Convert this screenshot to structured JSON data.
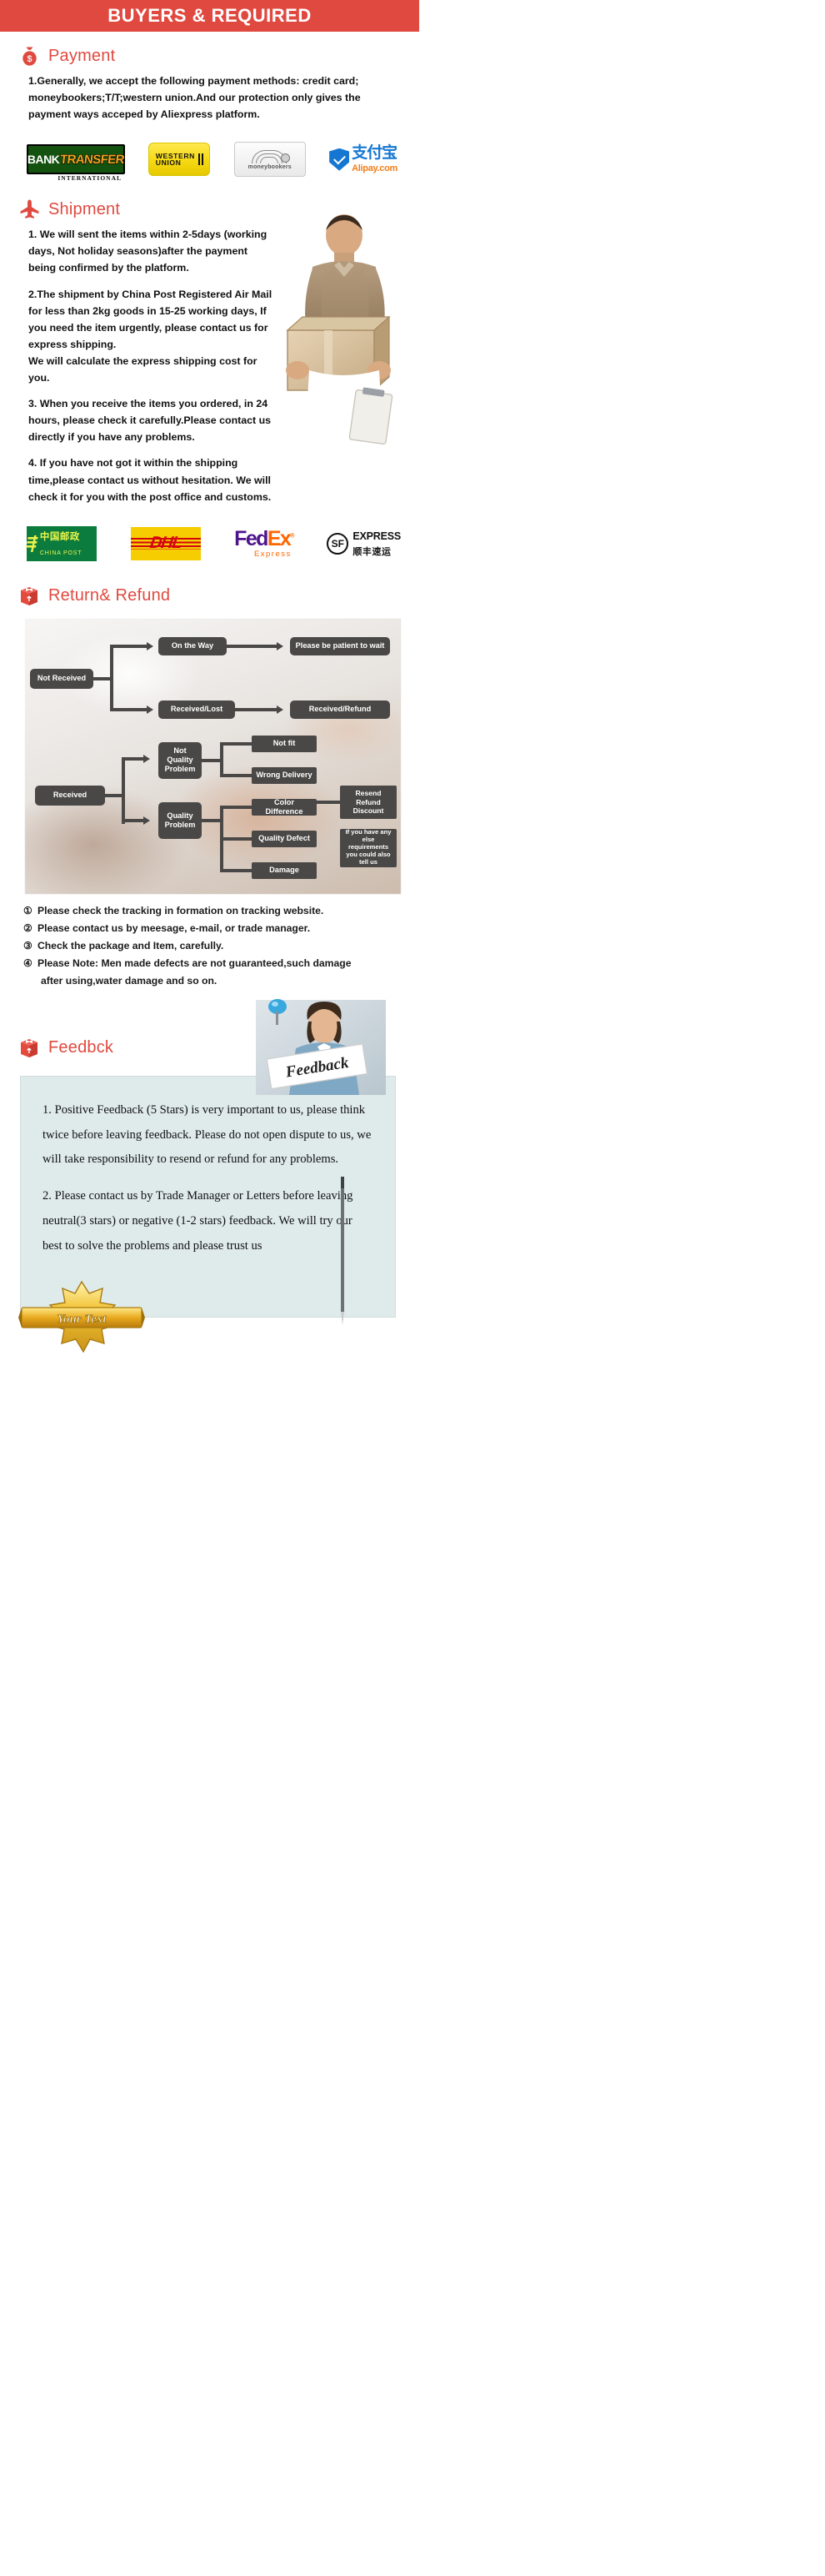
{
  "banner": {
    "title": "BUYERS & REQUIRED"
  },
  "payment": {
    "icon": "money-bag-icon",
    "heading": "Payment",
    "paragraphs": [
      "1.Generally, we accept the following payment methods: credit card; moneybookers;T/T;western union.And our protection only gives the payment ways acceped by Aliexpress platform."
    ],
    "logos": [
      {
        "name": "bank-transfer-international-logo",
        "line1": "BANK",
        "line2": "TRANSFER",
        "line3": "INTERNATIONAL"
      },
      {
        "name": "western-union-logo",
        "line1": "WESTERN",
        "line2": "UNION"
      },
      {
        "name": "moneybookers-logo",
        "label": "moneybookers"
      },
      {
        "name": "alipay-logo",
        "cn": "支付宝",
        "com": "Alipay.com"
      }
    ]
  },
  "shipment": {
    "icon": "airplane-icon",
    "heading": "Shipment",
    "paragraphs": [
      "1. We will sent the items within 2-5days (working days, Not holiday seasons)after the payment being confirmed by the platform.",
      "2.The shipment by China Post Registered Air Mail for less than  2kg goods in 15-25 working days, If  you need the item urgently, please contact us for express shipping.",
      "We will calculate the express shipping cost for you.",
      "3. When you receive the items you ordered, in 24 hours, please check it carefully.Please contact us directly if you have any problems.",
      "4. If you have not got it within the shipping time,please contact us without hesitation. We will check it for you with the post office and customs."
    ],
    "logos": [
      {
        "name": "china-post-logo",
        "cn": "中国邮政",
        "en": "CHINA POST"
      },
      {
        "name": "dhl-logo",
        "label": "DHL"
      },
      {
        "name": "fedex-logo",
        "fed": "Fed",
        "ex": "Ex",
        "sub": "Express"
      },
      {
        "name": "sf-express-logo",
        "mark": "SF",
        "en": "EXPRESS",
        "cn": "顺丰速运"
      }
    ]
  },
  "returns": {
    "icon": "package-return-icon",
    "heading": "Return& Refund",
    "flow": {
      "not_received": "Not Received",
      "on_the_way": "On the Way",
      "be_patient": "Please be patient to wait",
      "received_lost": "Received/Lost",
      "received_refund": "Received/Refund",
      "received": "Received",
      "not_quality_problem": "Not Quality Problem",
      "quality_problem": "Quality Problem",
      "not_fit": "Not fit",
      "wrong_delivery": "Wrong Delivery",
      "color_difference": "Color Difference",
      "quality_defect": "Quality Defect",
      "damage": "Damage",
      "resend_refund_discount": "Resend Refund Discount",
      "tell_us": "If you have any else requirements you could also tell us"
    },
    "notes": [
      {
        "num": "①",
        "text": "Please check the tracking in formation on tracking website."
      },
      {
        "num": "②",
        "text": "Please contact us by meesage, e-mail, or trade manager."
      },
      {
        "num": "③",
        "text": "Check the package and Item, carefully."
      },
      {
        "num": "④",
        "text": "Please Note: Men made defects  are not guaranteed,such damage",
        "sub": "after using,water damage and so on."
      }
    ]
  },
  "feedback": {
    "icon": "package-return-icon",
    "heading": "Feedbck",
    "photo_label": "Feedback",
    "paragraphs": [
      "1. Positive Feedback (5 Stars) is very important to us, please think twice before leaving feedback. Please do not open dispute to us,   we will take responsibility to resend or refund for any problems.",
      "2. Please contact us by Trade Manager or Letters before leaving neutral(3 stars) or negative (1-2 stars) feedback. We will try our best to solve the problems and please trust us"
    ],
    "badge_text": "Your Text"
  },
  "colors": {
    "brand_red": "#e0493f",
    "node_gray": "#4a4846",
    "panel_bg": "#dfeaea"
  }
}
